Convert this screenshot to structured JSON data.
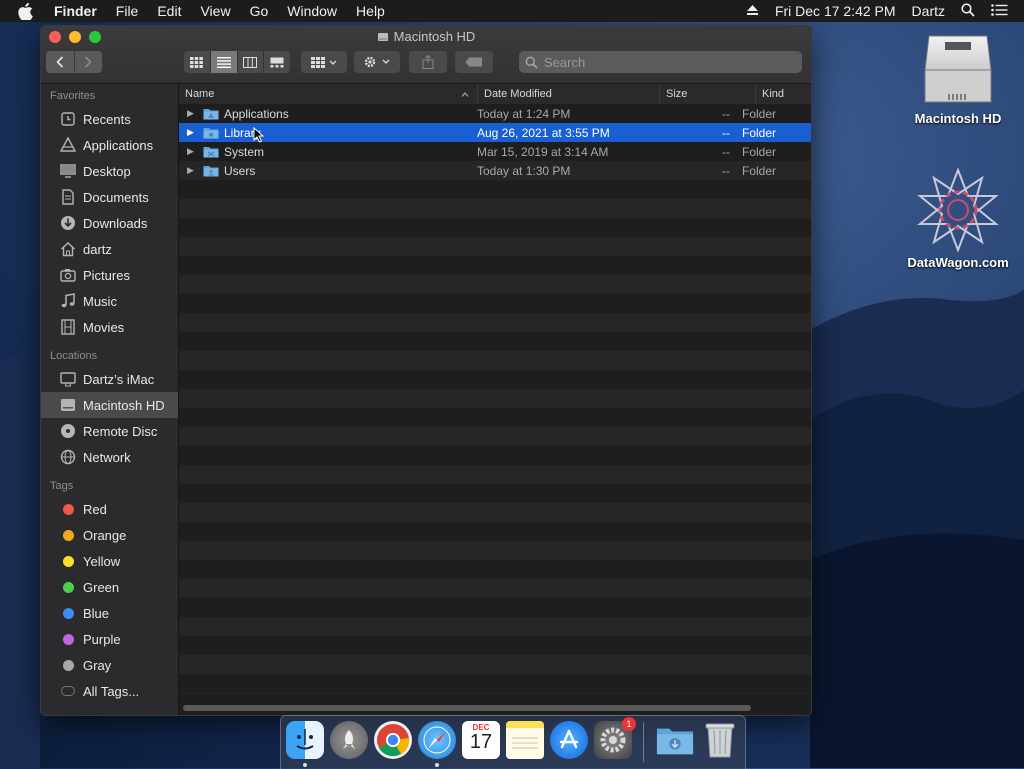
{
  "menubar": {
    "app_name": "Finder",
    "items": [
      "File",
      "Edit",
      "View",
      "Go",
      "Window",
      "Help"
    ],
    "clock": "Fri Dec 17  2:42 PM",
    "user": "Dartz"
  },
  "window": {
    "title": "Macintosh HD",
    "search_placeholder": "Search"
  },
  "sidebar": {
    "favorites_header": "Favorites",
    "favorites": [
      {
        "label": "Recents",
        "icon": "clock-icon"
      },
      {
        "label": "Applications",
        "icon": "applications-icon"
      },
      {
        "label": "Desktop",
        "icon": "desktop-icon"
      },
      {
        "label": "Documents",
        "icon": "document-icon"
      },
      {
        "label": "Downloads",
        "icon": "download-icon"
      },
      {
        "label": "dartz",
        "icon": "home-icon"
      },
      {
        "label": "Pictures",
        "icon": "camera-icon"
      },
      {
        "label": "Music",
        "icon": "music-note-icon"
      },
      {
        "label": "Movies",
        "icon": "film-icon"
      }
    ],
    "locations_header": "Locations",
    "locations": [
      {
        "label": "Dartz’s iMac",
        "icon": "imac-icon"
      },
      {
        "label": "Macintosh HD",
        "icon": "hard-drive-icon"
      },
      {
        "label": "Remote Disc",
        "icon": "disc-icon"
      },
      {
        "label": "Network",
        "icon": "globe-icon"
      }
    ],
    "tags_header": "Tags",
    "tags": [
      {
        "label": "Red",
        "color": "#f2564b"
      },
      {
        "label": "Orange",
        "color": "#f5a623"
      },
      {
        "label": "Yellow",
        "color": "#f7e12b"
      },
      {
        "label": "Green",
        "color": "#4ccf4c"
      },
      {
        "label": "Blue",
        "color": "#3b8cf5"
      },
      {
        "label": "Purple",
        "color": "#c266e0"
      },
      {
        "label": "Gray",
        "color": "#a8a8a8"
      }
    ],
    "all_tags": "All Tags..."
  },
  "columns": {
    "name": "Name",
    "date": "Date Modified",
    "size": "Size",
    "kind": "Kind"
  },
  "files": [
    {
      "name": "Applications",
      "date": "Today at 1:24 PM",
      "size": "--",
      "kind": "Folder"
    },
    {
      "name": "Library",
      "date": "Aug 26, 2021 at 3:55 PM",
      "size": "--",
      "kind": "Folder"
    },
    {
      "name": "System",
      "date": "Mar 15, 2019 at 3:14 AM",
      "size": "--",
      "kind": "Folder"
    },
    {
      "name": "Users",
      "date": "Today at 1:30 PM",
      "size": "--",
      "kind": "Folder"
    }
  ],
  "desktop": {
    "icons": [
      {
        "label": "Macintosh HD",
        "icon": "hard-drive-icon"
      },
      {
        "label": "DataWagon.com",
        "icon": "star-logo-icon"
      }
    ]
  },
  "dock": {
    "apps": [
      "finder-icon",
      "launchpad-icon",
      "chrome-icon",
      "safari-icon",
      "calendar-icon",
      "notes-icon",
      "app-store-icon",
      "system-preferences-icon",
      "downloads-folder-icon",
      "trash-icon"
    ],
    "calendar_month": "DEC",
    "calendar_day": "17",
    "prefs_badge": "1"
  }
}
